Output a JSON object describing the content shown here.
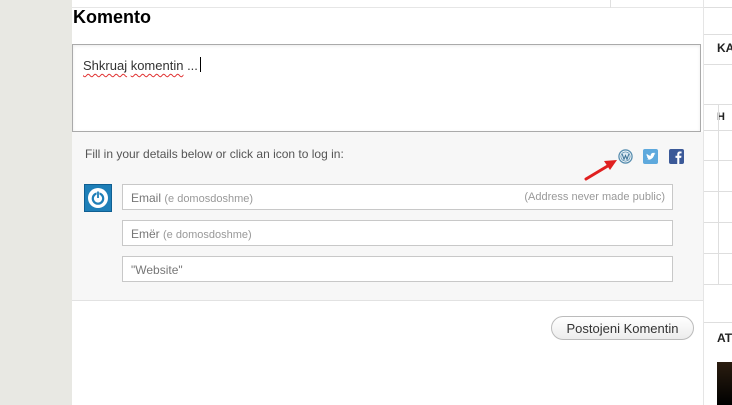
{
  "comments": {
    "title": "Komento",
    "placeholder_word1": "Shkruaj",
    "placeholder_word2": "komentin",
    "placeholder_rest": " ...",
    "login_prompt": "Fill in your details below or click an icon to log in:",
    "fields": {
      "email_label": "Email",
      "email_required": "(e domosdoshme)",
      "email_note": "(Address never made public)",
      "name_label": "Emër",
      "name_required": "(e domosdoshme)",
      "website_label": "\"Website\""
    },
    "submit_label": "Postojeni Komentin",
    "login_icons": [
      "wordpress-icon",
      "twitter-icon",
      "facebook-icon"
    ],
    "colors": {
      "accent": "#1e7fb8",
      "arrow": "#e02020",
      "twitter": "#5ea9dd",
      "facebook": "#3b5998"
    }
  },
  "sidebar": {
    "heading1": "KA",
    "table_header": "H",
    "heading2": "AT"
  }
}
